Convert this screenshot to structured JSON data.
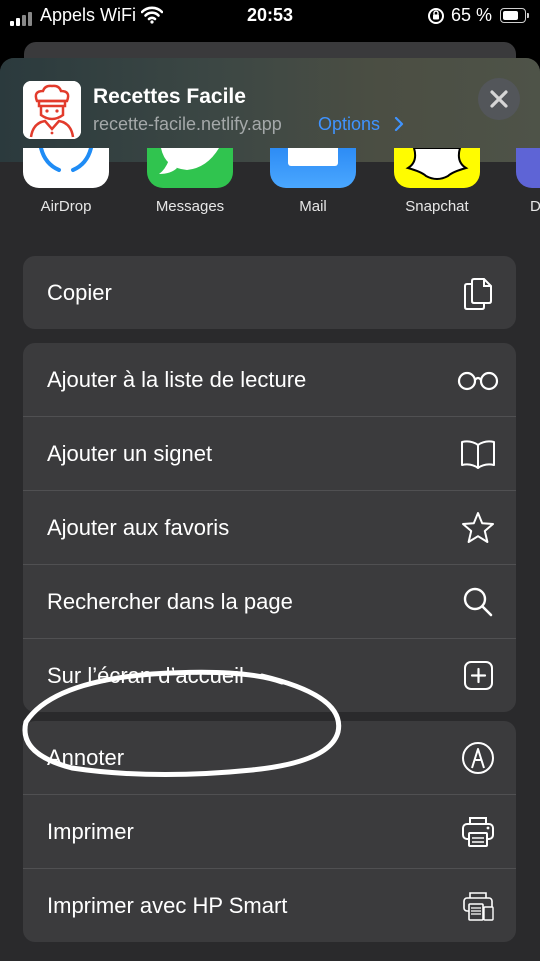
{
  "status_bar": {
    "carrier": "Appels WiFi",
    "time": "20:53",
    "battery_percent": "65 %",
    "battery_level": 0.65
  },
  "header": {
    "app_name": "Recettes Facile",
    "url": "recette-facile.netlify.app",
    "options_label": "Options",
    "app_icon": "chef-icon",
    "close_icon": "close-icon"
  },
  "share_apps": [
    {
      "label": "AirDrop",
      "icon": "airdrop-icon"
    },
    {
      "label": "Messages",
      "icon": "messages-icon"
    },
    {
      "label": "Mail",
      "icon": "mail-icon"
    },
    {
      "label": "Snapchat",
      "icon": "snapchat-icon"
    },
    {
      "label": "D",
      "icon": "app-icon"
    }
  ],
  "actions": {
    "group1": [
      {
        "label": "Copier",
        "icon": "copy-icon"
      }
    ],
    "group2": [
      {
        "label": "Ajouter à la liste de lecture",
        "icon": "glasses-icon"
      },
      {
        "label": "Ajouter un signet",
        "icon": "book-icon"
      },
      {
        "label": "Ajouter aux favoris",
        "icon": "star-icon"
      },
      {
        "label": "Rechercher dans la page",
        "icon": "search-icon"
      },
      {
        "label": "Sur l’écran d’accueil",
        "icon": "add-square-icon"
      }
    ],
    "group3": [
      {
        "label": "Annoter",
        "icon": "markup-icon"
      },
      {
        "label": "Imprimer",
        "icon": "printer-icon"
      },
      {
        "label": "Imprimer avec HP Smart",
        "icon": "hp-smart-icon"
      }
    ]
  },
  "colors": {
    "accent": "#3f93ff",
    "sheet_bg": "#2a2a2c",
    "row_bg": "#3b3b3d",
    "annotation": "#ffffff"
  }
}
